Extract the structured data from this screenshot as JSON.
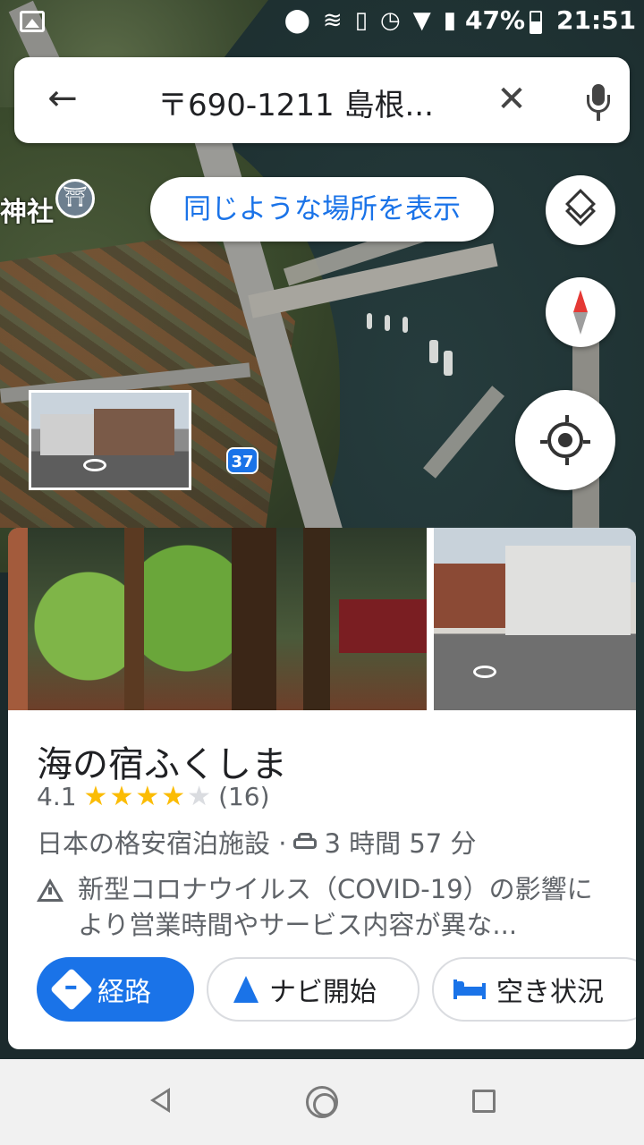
{
  "status_bar": {
    "battery_percent": "47%",
    "time": "21:51",
    "icons": [
      "gallery-icon",
      "location-icon",
      "nfc-icon",
      "vibrate-icon",
      "alarm-icon",
      "wifi-icon",
      "signal-icon",
      "battery-icon"
    ]
  },
  "search": {
    "query": "〒690-1211 島根..."
  },
  "map": {
    "place_label": "神社",
    "route_number": "37",
    "similar_places_chip": "同じような場所を表示"
  },
  "place": {
    "name": "海の宿ふくしま",
    "rating": "4.1",
    "stars_filled": 4,
    "stars_total": 5,
    "review_count": "(16)",
    "category": "日本の格安宿泊施設 ·",
    "drive_time": "3 時間 57 分",
    "notice": "新型コロナウイルス（COVID-19）の影響により営業時間やサービス内容が異な..."
  },
  "actions": {
    "route_label": "経路",
    "navigate_label": "ナビ開始",
    "availability_label": "空き状況"
  },
  "colors": {
    "accent": "#1a73e8",
    "star": "#fbbc04"
  }
}
